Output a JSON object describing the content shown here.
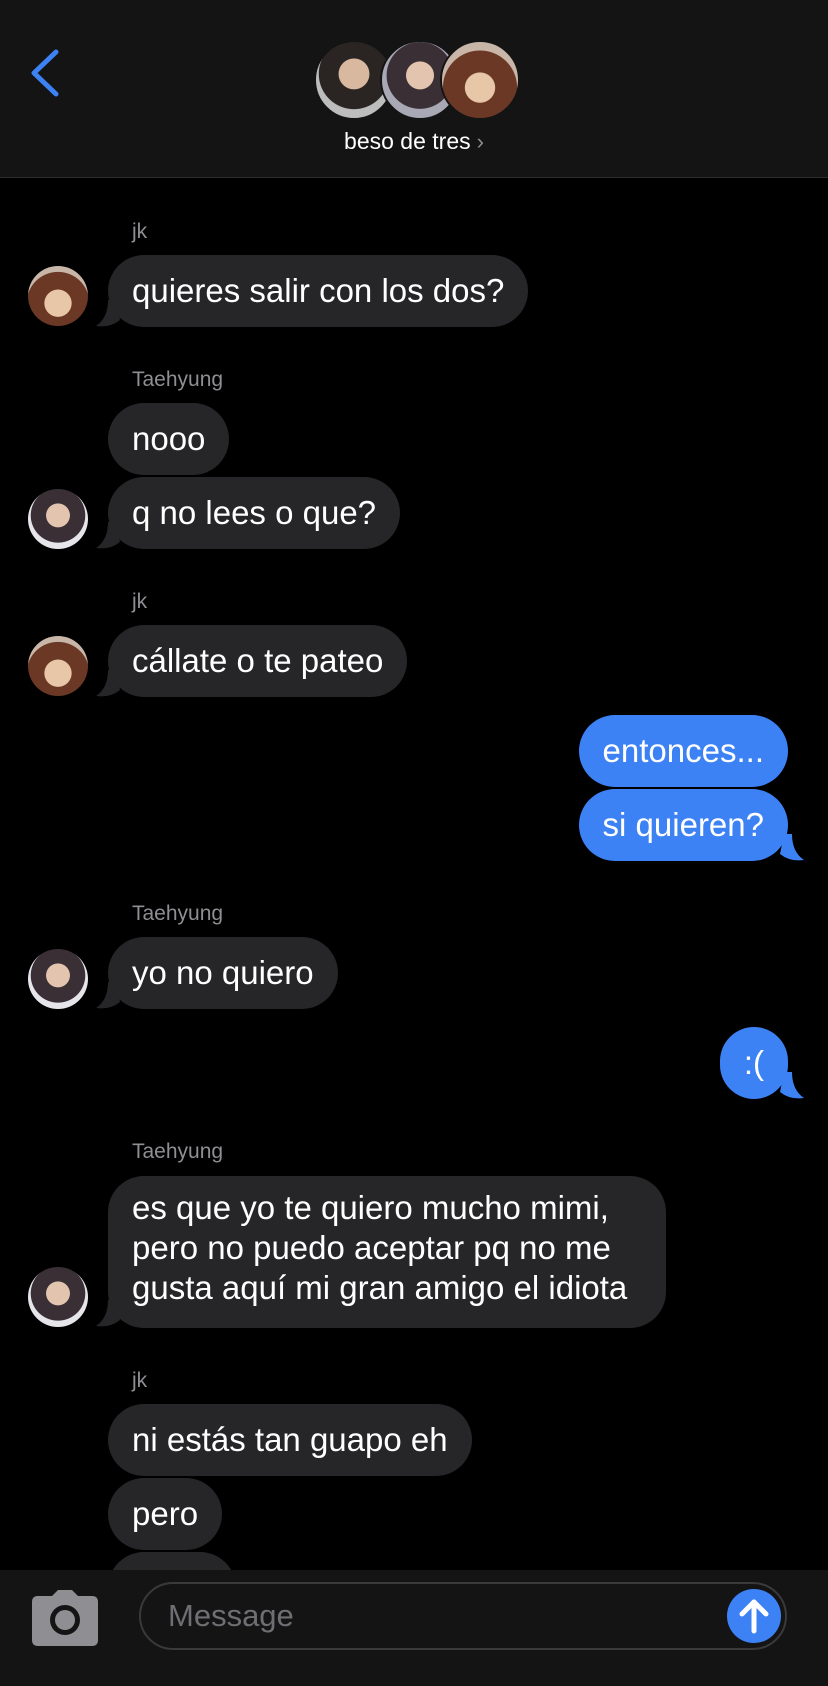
{
  "header": {
    "back_icon": "chevron-left-icon",
    "group_name": "beso de tres",
    "chevron": "›",
    "accent": "#3d82f5"
  },
  "messages": [
    {
      "sender": "jk",
      "text": "quieres salir con los dos?"
    },
    {
      "sender": "Taehyung",
      "text": "nooo"
    },
    {
      "text": "q no lees o que?"
    },
    {
      "sender": "jk",
      "text": "cállate o te pateo"
    },
    {
      "text": "entonces..."
    },
    {
      "text": "si quieren?"
    },
    {
      "sender": "Taehyung",
      "text": "yo no quiero"
    },
    {
      "text": ":("
    },
    {
      "sender": "Taehyung",
      "text": "es que yo te quiero mucho mimi, pero no puedo aceptar pq no me gusta aquí mi gran amigo el idiota"
    },
    {
      "sender": "jk",
      "text": "ni estás tan guapo eh"
    },
    {
      "text": "pero"
    }
  ],
  "composer": {
    "placeholder": "Message",
    "camera_icon": "camera-icon",
    "send_icon": "arrow-up-icon"
  }
}
